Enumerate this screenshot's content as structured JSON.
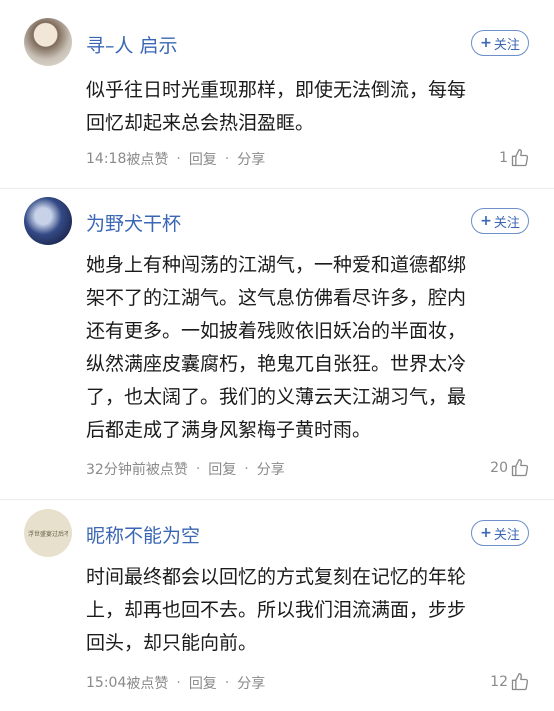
{
  "comments": [
    {
      "username": "寻–人 启示",
      "follow_label": "关注",
      "text": "似乎往日时光重现那样，即使无法倒流，每每\n回忆却起来总会热泪盈眶。",
      "time": "14:18",
      "like_action": "被点赞",
      "reply_label": "回复",
      "share_label": "分享",
      "likes": "1"
    },
    {
      "username": "为野犬干杯",
      "follow_label": "关注",
      "text": "她身上有种闯荡的江湖气，一种爱和道德都绑\n架不了的江湖气。这气息仿佛看尽许多，腔内\n还有更多。一如披着残败依旧妖冶的半面妆，\n纵然满座皮囊腐朽，艳鬼兀自张狂。世界太冷\n了，也太阔了。我们的义薄云天江湖习气，最\n后都走成了满身风絮梅子黄时雨。",
      "time": "32分钟前",
      "like_action": "被点赞",
      "reply_label": "回复",
      "share_label": "分享",
      "likes": "20"
    },
    {
      "username": "昵称不能为空",
      "follow_label": "关注",
      "text": "时间最终都会以回忆的方式复刻在记忆的年轮\n上，却再也回不去。所以我们泪流满面，步步\n回头，却只能向前。",
      "time": "15:04",
      "like_action": "被点赞",
      "reply_label": "回复",
      "share_label": "分享",
      "likes": "12",
      "avatar_text": "浮世盛宴过后不过一场梦"
    }
  ],
  "colors": {
    "username": "#3a66b4",
    "meta": "#8a8a8a",
    "text": "#1b1b1b"
  },
  "icons": {
    "follow": "plus-icon",
    "like": "thumbs-up-icon"
  }
}
